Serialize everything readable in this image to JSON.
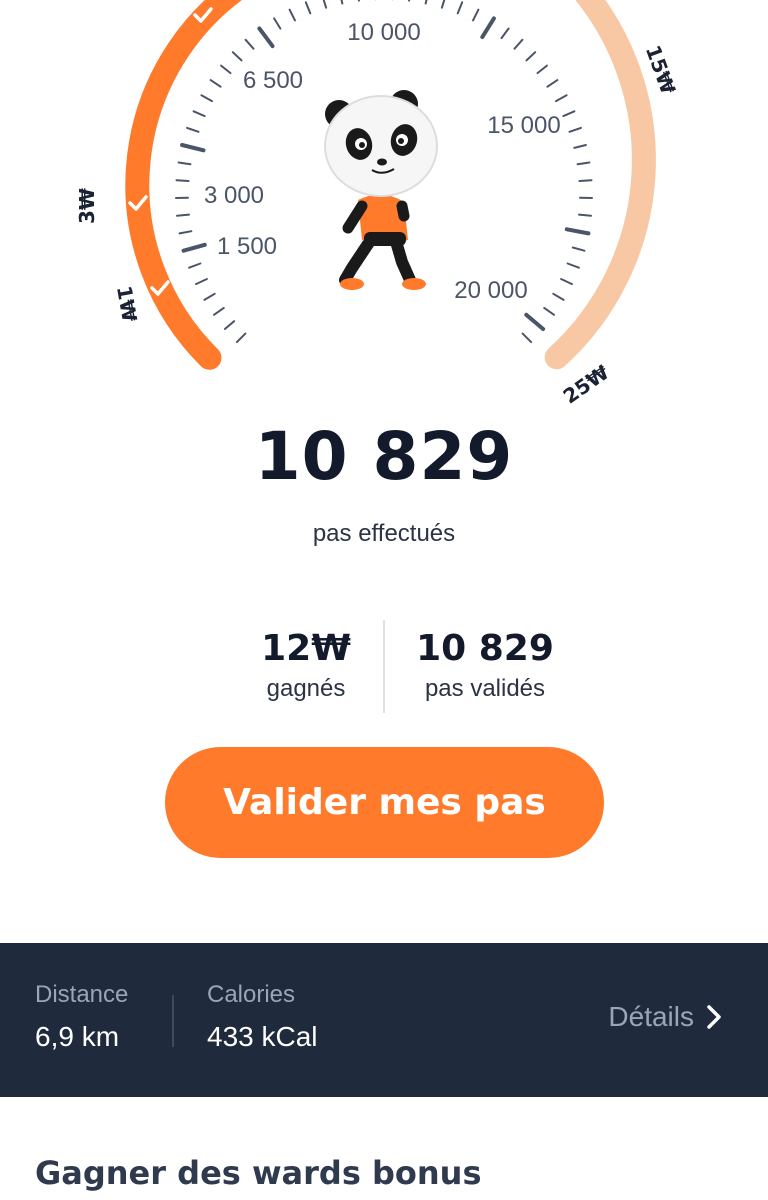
{
  "colors": {
    "accent": "#ff7a2b",
    "accent_light": "#f8c8a4",
    "dark_bar": "#1f2a3d",
    "text_dark": "#121a2c",
    "text_muted": "#9aa5b5",
    "tick": "#4a5568"
  },
  "gauge": {
    "step_labels": [
      "1 500",
      "3 000",
      "6 500",
      "10 000",
      "15 000",
      "20 000"
    ],
    "ward_labels": [
      "1₩",
      "3₩",
      "15₩",
      "25₩"
    ],
    "progress_steps": 10829,
    "mascot_icon": "panda-walking-icon"
  },
  "steps": {
    "count": "10 829",
    "label": "pas effectués"
  },
  "stats": {
    "earned_value": "12₩",
    "earned_label": "gagnés",
    "validated_value": "10 829",
    "validated_label": "pas validés"
  },
  "cta": {
    "label": "Valider mes pas"
  },
  "info": {
    "distance_label": "Distance",
    "distance_value": "6,9 km",
    "calories_label": "Calories",
    "calories_value": "433 kCal",
    "details_label": "Détails"
  },
  "bonus": {
    "title": "Gagner des wards bonus"
  }
}
